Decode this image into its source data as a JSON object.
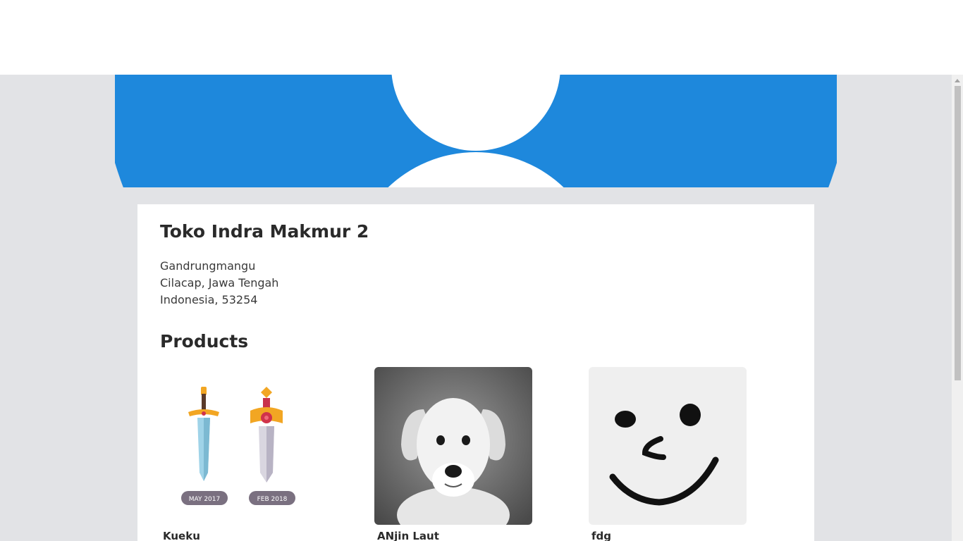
{
  "store": {
    "name": "Toko Indra Makmur 2",
    "address_line1": "Gandrungmangu",
    "address_line2": "Cilacap, Jawa Tengah",
    "address_line3": "Indonesia, 53254"
  },
  "products_heading": "Products",
  "products": [
    {
      "name": "Kueku",
      "badge1": "MAY 2017",
      "badge2": "FEB 2018"
    },
    {
      "name": "ANjin Laut"
    },
    {
      "name": "fdg"
    }
  ],
  "colors": {
    "banner_blue": "#1e88dc",
    "page_bg": "#e2e3e6"
  }
}
